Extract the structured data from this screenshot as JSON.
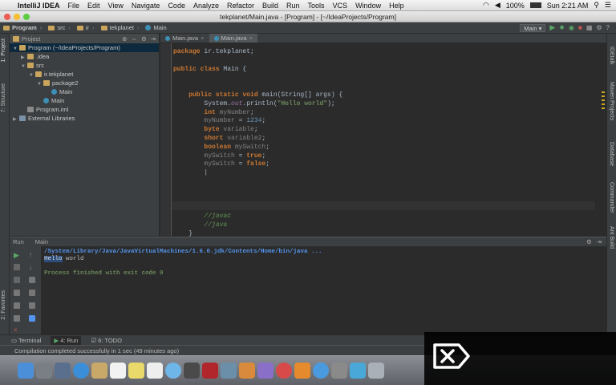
{
  "menubar": {
    "app_name": "IntelliJ IDEA",
    "items": [
      "File",
      "Edit",
      "View",
      "Navigate",
      "Code",
      "Analyze",
      "Refactor",
      "Build",
      "Run",
      "Tools",
      "VCS",
      "Window",
      "Help"
    ],
    "battery": "100%",
    "clock": "Sun 2:21 AM"
  },
  "window": {
    "title": "tekplanet/Main.java - [Program] - [~/IdeaProjects/Program]"
  },
  "navbar": {
    "crumbs": [
      "Program",
      "src",
      "ir",
      "tekplanet",
      "Main"
    ],
    "run_config": "Main"
  },
  "left_tabs": [
    "1: Project",
    "7: Structure",
    "2: Favorites"
  ],
  "right_tabs": [
    "IDEtalk",
    "Maven Projects",
    "Database",
    "Commander",
    "Ant Build"
  ],
  "project_panel": {
    "header": "Project",
    "tree": [
      {
        "label": "Program (~/IdeaProjects/Program)",
        "depth": 0,
        "type": "folder",
        "expanded": true
      },
      {
        "label": ".idea",
        "depth": 1,
        "type": "folder",
        "expanded": false
      },
      {
        "label": "src",
        "depth": 1,
        "type": "folder",
        "expanded": true
      },
      {
        "label": "ir.tekplanet",
        "depth": 2,
        "type": "folder",
        "expanded": true
      },
      {
        "label": "package2",
        "depth": 3,
        "type": "folder",
        "expanded": true
      },
      {
        "label": "Main",
        "depth": 4,
        "type": "class"
      },
      {
        "label": "Main",
        "depth": 3,
        "type": "class"
      },
      {
        "label": "Program.iml",
        "depth": 1,
        "type": "file"
      },
      {
        "label": "External Libraries",
        "depth": 0,
        "type": "library",
        "expanded": false
      }
    ]
  },
  "editor": {
    "tabs": [
      "Main.java",
      "Main.java"
    ],
    "active_tab": 1
  },
  "run_panel": {
    "header_label": "Run",
    "header_config": "Main",
    "console": {
      "command": "/System/Library/Java/JavaVirtualMachines/1.6.0.jdk/Contents/Home/bin/java ...",
      "output_hl": "Hello",
      "output_rest": " world",
      "exit": "Process finished with exit code 0"
    }
  },
  "bottom_tabs": [
    "Terminal",
    "4: Run",
    "6: TODO"
  ],
  "status": {
    "message": "Compilation completed successfully in 1 sec (49 minutes ago)"
  },
  "colors": {
    "keyword": "#cc7832",
    "string": "#6a8759",
    "field": "#9876aa",
    "comment": "#629755",
    "console_path": "#5394ec"
  }
}
